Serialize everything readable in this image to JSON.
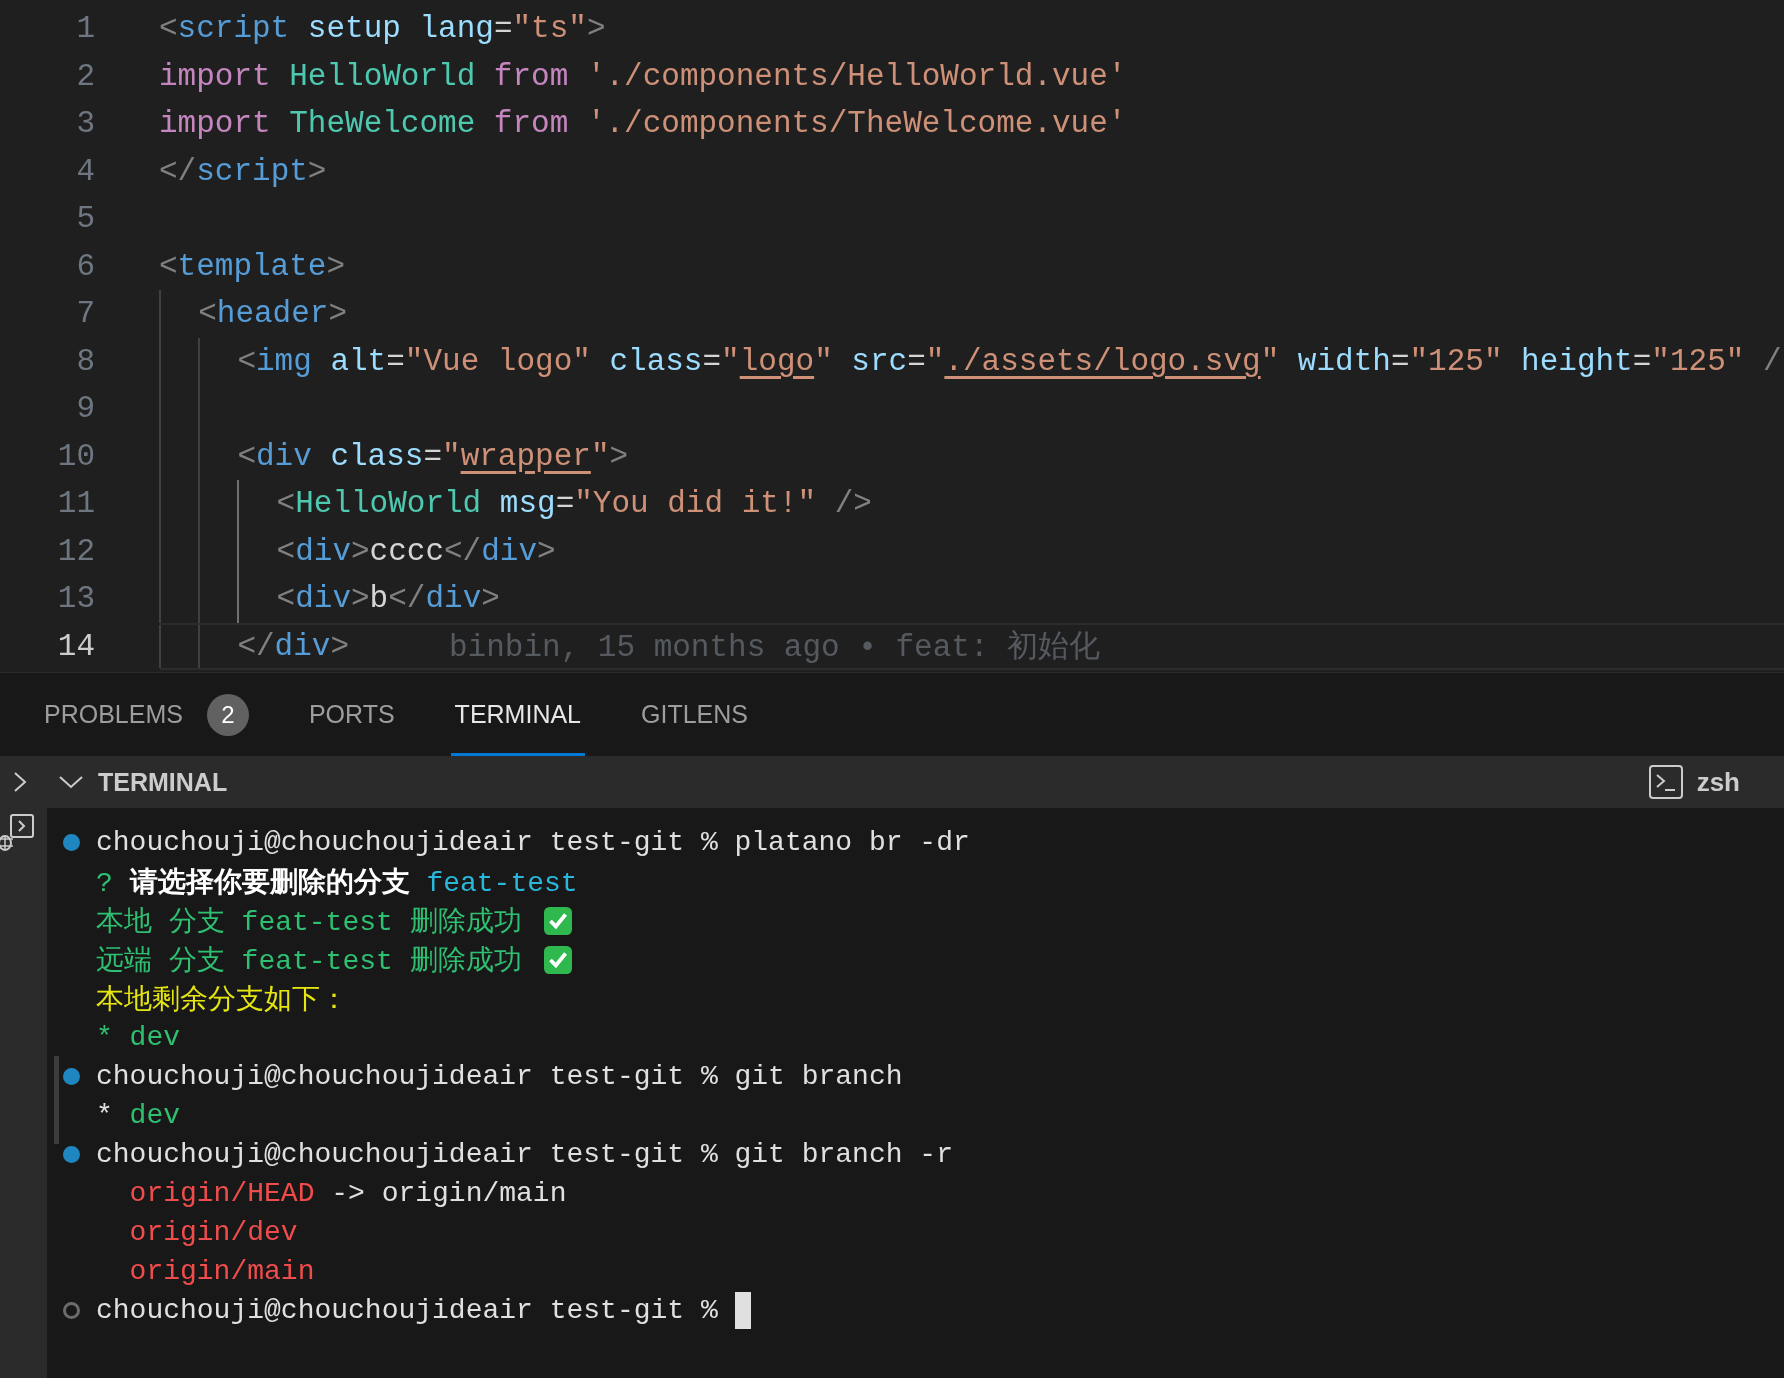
{
  "editor": {
    "lines": [
      {
        "number": "1",
        "current": false,
        "code": [
          {
            "kind": "punct",
            "text": "<"
          },
          {
            "kind": "tag",
            "text": "script"
          },
          {
            "kind": "attr",
            "text": " setup"
          },
          {
            "kind": "attr",
            "text": " lang"
          },
          {
            "kind": "plain",
            "text": "="
          },
          {
            "kind": "string",
            "text": "\"ts\""
          },
          {
            "kind": "punct",
            "text": ">"
          }
        ]
      },
      {
        "number": "2",
        "current": false,
        "code": [
          {
            "kind": "keyword",
            "text": "import"
          },
          {
            "kind": "component",
            "text": " HelloWorld"
          },
          {
            "kind": "keyword",
            "text": " from"
          },
          {
            "kind": "string",
            "text": " './components/HelloWorld.vue'"
          }
        ]
      },
      {
        "number": "3",
        "current": false,
        "code": [
          {
            "kind": "keyword",
            "text": "import"
          },
          {
            "kind": "component",
            "text": " TheWelcome"
          },
          {
            "kind": "keyword",
            "text": " from"
          },
          {
            "kind": "string",
            "text": " './components/TheWelcome.vue'"
          }
        ]
      },
      {
        "number": "4",
        "current": false,
        "code": [
          {
            "kind": "punct",
            "text": "</"
          },
          {
            "kind": "tag",
            "text": "script"
          },
          {
            "kind": "punct",
            "text": ">"
          }
        ]
      },
      {
        "number": "5",
        "current": false
      },
      {
        "number": "6",
        "current": false,
        "code": [
          {
            "kind": "punct",
            "text": "<"
          },
          {
            "kind": "tag",
            "text": "template"
          },
          {
            "kind": "punct",
            "text": ">"
          }
        ]
      },
      {
        "number": "7",
        "current": false,
        "code": [
          {
            "kind": "punct",
            "text": "  <"
          },
          {
            "kind": "tag",
            "text": "header"
          },
          {
            "kind": "punct",
            "text": ">"
          }
        ]
      },
      {
        "number": "8",
        "current": false,
        "code": [
          {
            "kind": "punct",
            "text": "    <"
          },
          {
            "kind": "tag",
            "text": "img"
          },
          {
            "kind": "attr",
            "text": " alt"
          },
          {
            "kind": "plain",
            "text": "="
          },
          {
            "kind": "string",
            "text": "\"Vue logo\""
          },
          {
            "kind": "attr",
            "text": " class"
          },
          {
            "kind": "plain",
            "text": "="
          },
          {
            "kind": "string",
            "text": "\""
          },
          {
            "kind": "link",
            "text": "logo"
          },
          {
            "kind": "string",
            "text": "\""
          },
          {
            "kind": "attr",
            "text": " src"
          },
          {
            "kind": "plain",
            "text": "="
          },
          {
            "kind": "string",
            "text": "\""
          },
          {
            "kind": "link",
            "text": "./assets/logo.svg"
          },
          {
            "kind": "string",
            "text": "\""
          },
          {
            "kind": "attr",
            "text": " width"
          },
          {
            "kind": "plain",
            "text": "="
          },
          {
            "kind": "string",
            "text": "\"125\""
          },
          {
            "kind": "attr",
            "text": " height"
          },
          {
            "kind": "plain",
            "text": "="
          },
          {
            "kind": "string",
            "text": "\"125\""
          },
          {
            "kind": "punct",
            "text": " /"
          }
        ]
      },
      {
        "number": "9",
        "current": false
      },
      {
        "number": "10",
        "current": false,
        "code": [
          {
            "kind": "punct",
            "text": "    <"
          },
          {
            "kind": "tag",
            "text": "div"
          },
          {
            "kind": "attr",
            "text": " class"
          },
          {
            "kind": "plain",
            "text": "="
          },
          {
            "kind": "string",
            "text": "\""
          },
          {
            "kind": "link",
            "text": "wrapper"
          },
          {
            "kind": "string",
            "text": "\""
          },
          {
            "kind": "punct",
            "text": ">"
          }
        ]
      },
      {
        "number": "11",
        "current": false,
        "code": [
          {
            "kind": "punct",
            "text": "      <"
          },
          {
            "kind": "component",
            "text": "HelloWorld"
          },
          {
            "kind": "attr",
            "text": " msg"
          },
          {
            "kind": "plain",
            "text": "="
          },
          {
            "kind": "string",
            "text": "\"You did it!\""
          },
          {
            "kind": "punct",
            "text": " />"
          }
        ]
      },
      {
        "number": "12",
        "current": false,
        "code": [
          {
            "kind": "punct",
            "text": "      <"
          },
          {
            "kind": "tag",
            "text": "div"
          },
          {
            "kind": "punct",
            "text": ">"
          },
          {
            "kind": "plain",
            "text": "cccc"
          },
          {
            "kind": "punct",
            "text": "</"
          },
          {
            "kind": "tag",
            "text": "div"
          },
          {
            "kind": "punct",
            "text": ">"
          }
        ]
      },
      {
        "number": "13",
        "current": false,
        "code": [
          {
            "kind": "punct",
            "text": "      <"
          },
          {
            "kind": "tag",
            "text": "div"
          },
          {
            "kind": "punct",
            "text": ">"
          },
          {
            "kind": "plain",
            "text": "b"
          },
          {
            "kind": "punct",
            "text": "</"
          },
          {
            "kind": "tag",
            "text": "div"
          },
          {
            "kind": "punct",
            "text": ">"
          }
        ]
      },
      {
        "number": "14",
        "current": true,
        "code": [
          {
            "kind": "punct",
            "text": "    </"
          },
          {
            "kind": "tag",
            "text": "div"
          },
          {
            "kind": "punct",
            "text": ">"
          }
        ],
        "blame": "binbin, 15 months ago • feat: 初始化"
      }
    ]
  },
  "panel": {
    "tabs": [
      {
        "label": "PROBLEMS",
        "selected": false,
        "badge": "2"
      },
      {
        "label": "PORTS",
        "selected": false
      },
      {
        "label": "TERMINAL",
        "selected": true
      },
      {
        "label": "GITLENS",
        "selected": false
      }
    ],
    "section_title": "TERMINAL",
    "shell": "zsh",
    "terminal": [
      {
        "kind": "command",
        "done": true,
        "segments": [
          {
            "kind": "plain",
            "text": "chouchouji@chouchoujideair test-git % platano br -dr"
          }
        ]
      },
      {
        "kind": "output",
        "segments": [
          {
            "kind": "green",
            "text": "? "
          },
          {
            "kind": "bold",
            "text": "请选择你要删除的分支"
          },
          {
            "kind": "cyan",
            "text": " feat-test"
          }
        ]
      },
      {
        "kind": "output",
        "segments": [
          {
            "kind": "green",
            "text": "本地 分支 feat-test 删除成功"
          },
          {
            "kind": "check"
          }
        ]
      },
      {
        "kind": "output",
        "segments": [
          {
            "kind": "green",
            "text": "远端 分支 feat-test 删除成功"
          },
          {
            "kind": "check"
          }
        ]
      },
      {
        "kind": "output",
        "segments": [
          {
            "kind": "yellow",
            "text": "本地剩余分支如下："
          }
        ]
      },
      {
        "kind": "output",
        "segments": [
          {
            "kind": "green",
            "text": "* dev"
          }
        ]
      },
      {
        "kind": "command",
        "done": true,
        "segments": [
          {
            "kind": "plain",
            "text": "chouchouji@chouchoujideair test-git % git branch"
          }
        ]
      },
      {
        "kind": "output",
        "segments": [
          {
            "kind": "plain",
            "text": "* "
          },
          {
            "kind": "green",
            "text": "dev"
          }
        ]
      },
      {
        "kind": "command",
        "done": true,
        "segments": [
          {
            "kind": "plain",
            "text": "chouchouji@chouchoujideair test-git % git branch -r"
          }
        ]
      },
      {
        "kind": "output",
        "segments": [
          {
            "kind": "red",
            "text": "  origin/HEAD"
          },
          {
            "kind": "plain",
            "text": " -> origin/main"
          }
        ]
      },
      {
        "kind": "output",
        "segments": [
          {
            "kind": "red",
            "text": "  origin/dev"
          }
        ]
      },
      {
        "kind": "output",
        "segments": [
          {
            "kind": "red",
            "text": "  origin/main"
          }
        ]
      },
      {
        "kind": "command",
        "done": false,
        "cursor": true,
        "segments": [
          {
            "kind": "plain",
            "text": "chouchouji@chouchoujideair test-git %"
          }
        ]
      }
    ]
  }
}
